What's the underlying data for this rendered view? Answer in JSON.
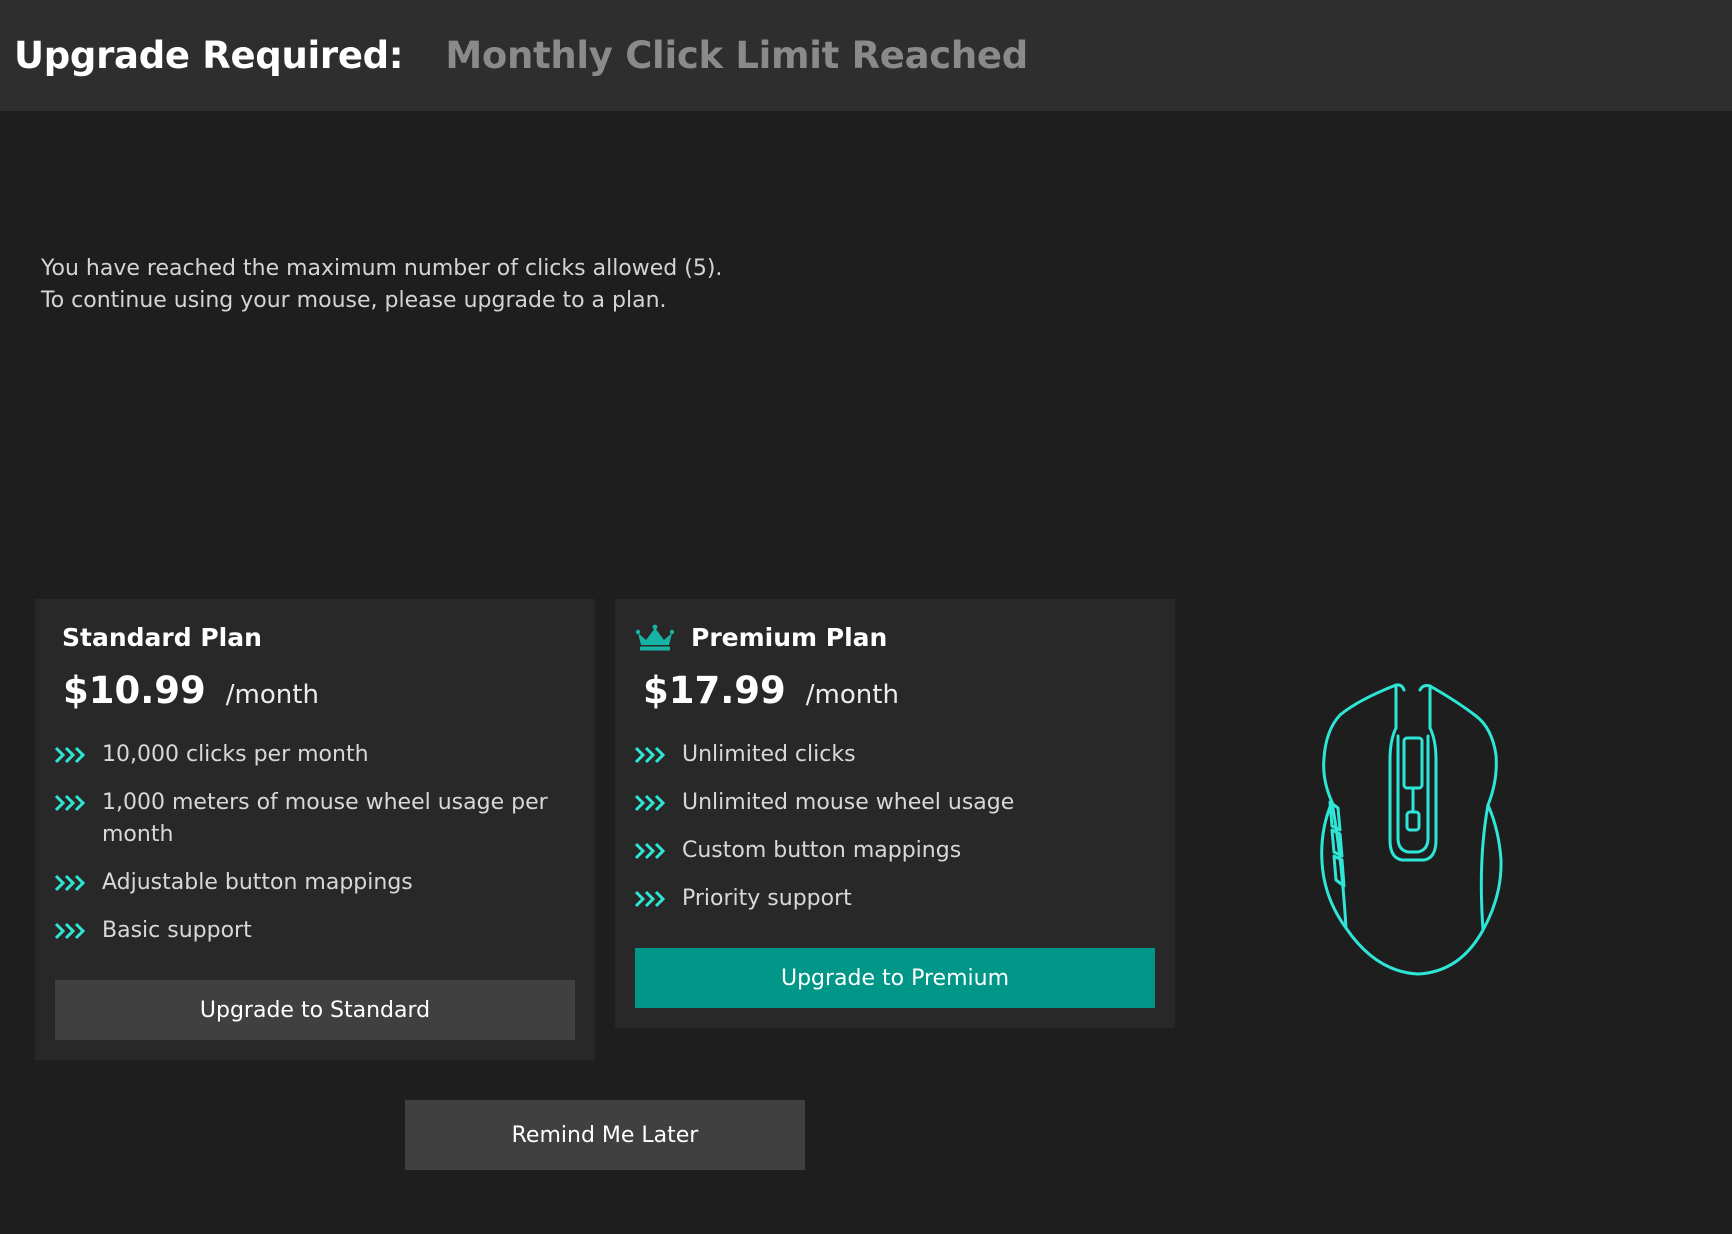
{
  "header": {
    "title": "Upgrade Required:",
    "subtitle": "Monthly Click Limit Reached"
  },
  "message": {
    "line1": "You have reached the maximum number of clicks allowed (5).",
    "line2": "To continue using your mouse, please upgrade to a plan."
  },
  "plans": {
    "standard": {
      "title": "Standard Plan",
      "price": "$10.99",
      "period": "/month",
      "features": [
        "10,000 clicks per month",
        "1,000 meters of mouse wheel usage per month",
        "Adjustable button mappings",
        "Basic support"
      ],
      "button_label": "Upgrade to Standard"
    },
    "premium": {
      "title": "Premium Plan",
      "price": "$17.99",
      "period": "/month",
      "features": [
        "Unlimited clicks",
        "Unlimited mouse wheel usage",
        "Custom button mappings",
        "Priority support"
      ],
      "button_label": "Upgrade to Premium"
    }
  },
  "remind_label": "Remind Me Later",
  "icons": {
    "feature_bullet": "triple-chevron-right-icon",
    "premium_badge": "crown-icon",
    "illustration": "mouse-icon"
  },
  "colors": {
    "accent": "#2ee6d6",
    "premium_button": "#009688",
    "secondary_button": "#404040",
    "header_bg": "#2e2e2e",
    "page_bg": "#1e1e1e",
    "card_bg": "#282828"
  }
}
